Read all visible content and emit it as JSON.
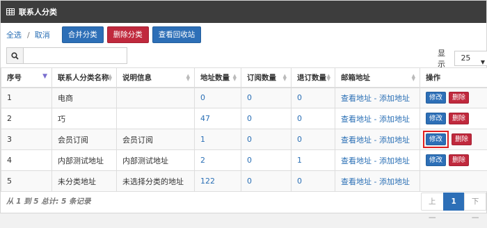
{
  "header": {
    "title": "联系人分类",
    "icon": "table-icon"
  },
  "toolbar": {
    "select_all": "全选",
    "separator": "/",
    "cancel": "取消",
    "merge": "合并分类",
    "delete": "删除分类",
    "recycle": "查看回收站"
  },
  "search": {
    "value": "",
    "icon": "search-icon"
  },
  "page_size": {
    "label": "显示",
    "value": "25"
  },
  "columns": [
    "序号",
    "联系人分类名称",
    "说明信息",
    "地址数量",
    "订阅数量",
    "退订数量",
    "邮箱地址",
    "操作"
  ],
  "rows": [
    {
      "id": "1",
      "name": "电商",
      "desc": "",
      "addr_count": "0",
      "sub": "0",
      "unsub": "0",
      "view": "查看地址",
      "dash": " - ",
      "add": "添加地址",
      "edit": "修改",
      "del": "删除"
    },
    {
      "id": "2",
      "name": "巧",
      "desc": "",
      "addr_count": "47",
      "sub": "0",
      "unsub": "0",
      "view": "查看地址",
      "dash": " - ",
      "add": "添加地址",
      "edit": "修改",
      "del": "删除"
    },
    {
      "id": "3",
      "name": "会员订阅",
      "desc": "会员订阅",
      "addr_count": "1",
      "sub": "0",
      "unsub": "0",
      "view": "查看地址",
      "dash": " - ",
      "add": "添加地址",
      "edit": "修改",
      "del": "删除"
    },
    {
      "id": "4",
      "name": "内部测试地址",
      "desc": "内部测试地址",
      "addr_count": "2",
      "sub": "0",
      "unsub": "1",
      "view": "查看地址",
      "dash": " - ",
      "add": "添加地址",
      "edit": "修改",
      "del": "删除"
    },
    {
      "id": "5",
      "name": "未分类地址",
      "desc": "未选择分类的地址",
      "addr_count": "122",
      "sub": "0",
      "unsub": "0",
      "view": "查看地址",
      "dash": " - ",
      "add": "添加地址",
      "edit": "",
      "del": ""
    }
  ],
  "footer": {
    "info": "从 1 到 5 总计: 5 条记录",
    "prev": "上一页",
    "current": "1",
    "next": "下一"
  },
  "colors": {
    "titlebar": "#3d3d3d",
    "primary": "#2d6fb7",
    "danger": "#c0293d",
    "highlight": "#e02020"
  }
}
